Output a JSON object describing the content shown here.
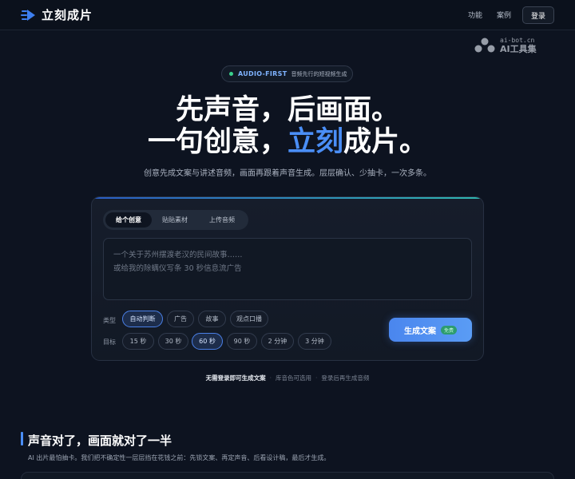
{
  "nav": {
    "brand": "立刻成片",
    "links": [
      "功能",
      "案例"
    ],
    "login": "登录"
  },
  "watermark": {
    "url": "ai-bot.cn",
    "name": "AI工具集"
  },
  "badge": {
    "en": "AUDIO-FIRST",
    "zh": "音频先行的短视频生成"
  },
  "hero": {
    "line1": "先声音，后画面。",
    "line2_before": "一句创意，",
    "line2_accent": "立刻",
    "line2_after": "成片。"
  },
  "subtitle": "创意先成文案与讲述音频，画面再跟着声音生成。层层确认、少抽卡，一次多条。",
  "card": {
    "tabs": [
      "给个创意",
      "贴贴素材",
      "上传音频"
    ],
    "active_tab": 0,
    "placeholder_line1": "一个关于苏州摆渡老汉的民间故事……",
    "placeholder_line2": "或给我的除螨仪写条 30 秒信息流广告",
    "type_label": "类型",
    "type_options": [
      "自动判断",
      "广告",
      "故事",
      "观点口播"
    ],
    "type_selected": "自动判断",
    "duration_label": "目标",
    "duration_options": [
      "15 秒",
      "30 秒",
      "60 秒",
      "90 秒",
      "2 分钟",
      "3 分钟"
    ],
    "duration_selected": "60 秒",
    "generate_label": "生成文案",
    "generate_tag": "免费"
  },
  "footnote": {
    "strong": "无需登录即可生成文案",
    "item2": "库音色可选用",
    "item3": "登录后再生成音频"
  },
  "section": {
    "title": "声音对了，画面就对了一半",
    "subtitle": "AI 出片最怕抽卡。我们把不确定性一层层挡在花钱之前：先锁文案、再定声音、后看设计稿，最后才生成。"
  },
  "colors": {
    "background": "#0d1320",
    "accent": "#4a8ef6",
    "badge_dot": "#3ad18c",
    "generate_tag": "#2d9c6e"
  }
}
